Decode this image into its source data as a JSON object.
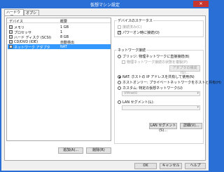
{
  "window": {
    "title": "仮想マシン設定",
    "close": "✕"
  },
  "tabs": [
    {
      "label": "ハードウェア",
      "active": true
    },
    {
      "label": "オプション",
      "active": false
    }
  ],
  "devices": {
    "col_device": "デバイス",
    "col_summary": "概要",
    "items": [
      {
        "name": "メモリ",
        "summary": "1 GB",
        "icon": "memory-icon"
      },
      {
        "name": "プロセッサ",
        "summary": "1",
        "icon": "processor-icon"
      },
      {
        "name": "ハード ディスク (SCSI)",
        "summary": "8 GB",
        "icon": "hard-disk-icon"
      },
      {
        "name": "CD/DVD (IDE)",
        "summary": "自動検出",
        "icon": "cd-dvd-icon"
      },
      {
        "name": "ネットワーク アダプタ",
        "summary": "NAT",
        "icon": "network-adapter-icon",
        "selected": true
      }
    ],
    "add_label": "追加(A)...",
    "remove_label": "削除(R)"
  },
  "device_status": {
    "title": "デバイスのステータス",
    "connected": "接続済み(C)",
    "connect_on_power": "パワーオン時に接続(O)"
  },
  "network": {
    "title": "ネットワーク接続",
    "bridged": "ブリッジ: 物理ネットワークに直接接続(B)",
    "replicate": "物理ネットワーク接続の状態を複製(P)",
    "configure_adapter": "アダプタの構成(G)...",
    "nat": "NAT: ホストの IP アドレスを共有して使用(N)",
    "host_only": "ホストオンリー: プライベートネットワークをホストと共有(H)",
    "custom": "カスタム: 特定の仮想ネットワーク(U)",
    "custom_value": "VMnet0",
    "lan": "LAN セグメント(L):",
    "lan_value": "",
    "lan_segments": "LAN セグメント(S)...",
    "advanced": "詳細(V)..."
  },
  "footer": {
    "ok": "OK",
    "cancel": "キャンセル",
    "help": "ヘルプ"
  }
}
